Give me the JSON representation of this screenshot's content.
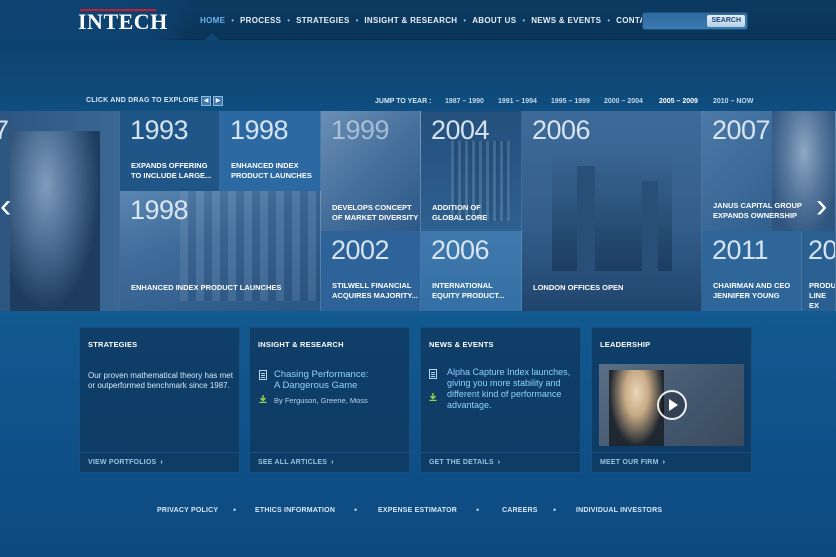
{
  "header": {
    "logo_text": "INTECH",
    "nav": [
      {
        "label": "HOME",
        "active": true
      },
      {
        "label": "PROCESS",
        "active": false
      },
      {
        "label": "STRATEGIES",
        "active": false
      },
      {
        "label": "INSIGHT & RESEARCH",
        "active": false
      },
      {
        "label": "ABOUT US",
        "active": false
      },
      {
        "label": "NEWS & EVENTS",
        "active": false
      },
      {
        "label": "CONTACT US",
        "active": false
      }
    ],
    "search": {
      "value": "",
      "placeholder": "",
      "button_label": "SEARCH"
    }
  },
  "timeline": {
    "explore_label": "CLICK AND DRAG TO EXPLORE",
    "prev_arrow": "◀",
    "next_arrow": "▶",
    "jump_label": "JUMP TO YEAR :",
    "ranges": [
      {
        "label": "1987 – 1990",
        "active": false
      },
      {
        "label": "1991 – 1994",
        "active": false
      },
      {
        "label": "1995 – 1999",
        "active": false
      },
      {
        "label": "2000 – 2004",
        "active": false
      },
      {
        "label": "2005 – 2009",
        "active": true
      },
      {
        "label": "2010 – NOW",
        "active": false
      }
    ],
    "tiles": [
      {
        "year": "7",
        "caption": ""
      },
      {
        "year": "1993",
        "caption": "EXPANDS OFFERING\nTO INCLUDE LARGE..."
      },
      {
        "year": "1998",
        "caption": "ENHANCED INDEX\nPRODUCT LAUNCHES"
      },
      {
        "year": "1998",
        "caption": "ENHANCED INDEX PRODUCT LAUNCHES"
      },
      {
        "year": "1999",
        "caption": "DEVELOPS CONCEPT\nOF MARKET DIVERSITY"
      },
      {
        "year": "2002",
        "caption": "STILWELL FINANCIAL\nACQUIRES MAJORITY..."
      },
      {
        "year": "2004",
        "caption": "ADDITION OF\nGLOBAL CORE"
      },
      {
        "year": "2006",
        "caption": "INTERNATIONAL\nEQUITY PRODUCT..."
      },
      {
        "year": "2006",
        "caption": "LONDON OFFICES OPEN"
      },
      {
        "year": "2007",
        "caption": "JANUS CAPITAL GROUP\nEXPANDS OWNERSHIP"
      },
      {
        "year": "2011",
        "caption": "CHAIRMAN AND CEO\nJENNIFER YOUNG"
      },
      {
        "year": "20",
        "caption": "PRODU\nLINE EX"
      }
    ],
    "chevron_left": "‹",
    "chevron_right": "›"
  },
  "cards": {
    "strategies": {
      "title": "STRATEGIES",
      "body": "Our proven mathematical theory has met or outperformed benchmark since 1987.",
      "footer": "VIEW PORTFOLIOS"
    },
    "insight": {
      "title": "INSIGHT & RESEARCH",
      "article_title": "Chasing Performance:\nA Dangerous Game",
      "article_by": "By Ferguson, Greene, Moss",
      "footer": "SEE ALL ARTICLES"
    },
    "news": {
      "title": "NEWS & EVENTS",
      "body": "Alpha Capture Index launches, giving you more stability and different kind of performance advantage.",
      "footer": "GET THE DETAILS"
    },
    "leadership": {
      "title": "LEADERSHIP",
      "footer": "MEET OUR FIRM"
    },
    "chevron": "›"
  },
  "footer": {
    "links": [
      "PRIVACY POLICY",
      "ETHICS INFORMATION",
      "EXPENSE ESTIMATOR",
      "CAREERS",
      "INDIVIDUAL INVESTORS"
    ],
    "separator": "•"
  },
  "colors": {
    "accent": "#6cb3ea",
    "logo_bar": "#c51f2e",
    "link": "#8fd0ff"
  }
}
